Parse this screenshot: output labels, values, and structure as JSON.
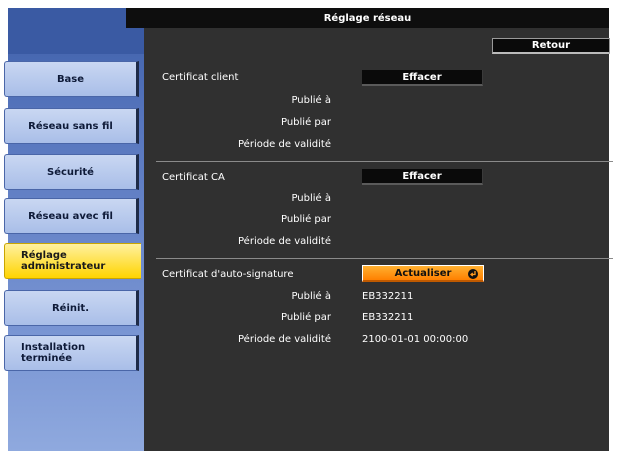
{
  "header": {
    "title": "Réglage réseau"
  },
  "toolbar": {
    "back_label": "Retour"
  },
  "sidebar": {
    "items": [
      {
        "label": "Base"
      },
      {
        "label": "Réseau sans fil"
      },
      {
        "label": "Sécurité"
      },
      {
        "label": "Réseau avec fil"
      },
      {
        "label_line1": "Réglage",
        "label_line2": "administrateur",
        "active": true
      },
      {
        "label": "Réinit."
      },
      {
        "label_line1": "Installation",
        "label_line2": "terminée"
      }
    ]
  },
  "sections": {
    "client": {
      "title": "Certificat client",
      "button_label": "Effacer",
      "issued_to_label": "Publié à",
      "issued_by_label": "Publié par",
      "validity_label": "Période de validité"
    },
    "ca": {
      "title": "Certificat CA",
      "button_label": "Effacer",
      "issued_to_label": "Publié à",
      "issued_by_label": "Publié par",
      "validity_label": "Période de validité"
    },
    "self_signed": {
      "title": "Certificat d'auto-signature",
      "button_label": "Actualiser",
      "issued_to_label": "Publié à",
      "issued_to_value": "EB332211",
      "issued_by_label": "Publié par",
      "issued_by_value": "EB332211",
      "validity_label": "Période de validité",
      "validity_value": "2100-01-01 00:00:00"
    }
  },
  "colors": {
    "active_tab": "#ffd400",
    "accent_button": "#ff8000",
    "sidebar_blue": "#5675bd",
    "background": "#303030"
  }
}
